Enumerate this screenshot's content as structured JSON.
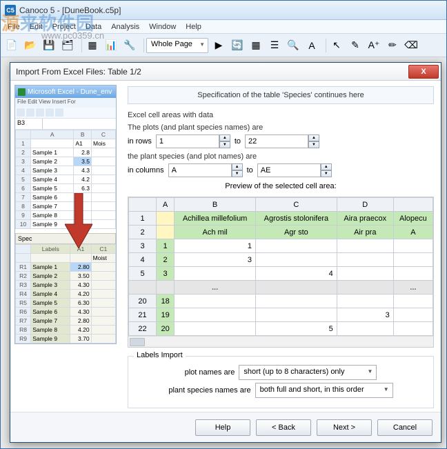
{
  "window": {
    "title": "Canoco 5 - [DuneBook.c5p]",
    "icon_label": "C5"
  },
  "watermark": {
    "main_a": "源",
    "main_b": "来软件园",
    "sub": "www.pc0359.cn"
  },
  "menubar": [
    "File",
    "Edit",
    "Project",
    "Data",
    "Analysis",
    "Window",
    "Help"
  ],
  "toolbar": {
    "zoom": "Whole Page"
  },
  "dialog": {
    "title": "Import From Excel Files: Table 1/2",
    "close": "X",
    "spec_header": "Specification of the table 'Species' continues here",
    "cell_areas_label": "Excel cell areas with data",
    "rows_label": "The plots (and plant species names) are",
    "in_rows": "in rows",
    "from_row": "1",
    "to_label": "to",
    "to_row": "22",
    "cols_label": "the plant species (and plot names) are",
    "in_cols": "in columns",
    "from_col": "A",
    "to_col": "AE",
    "preview_label": "Preview of the selected cell area:",
    "preview": {
      "cols": [
        "A",
        "B",
        "C",
        "D",
        ""
      ],
      "rows": [
        {
          "n": "1",
          "a": "",
          "b": "Achillea millefolium",
          "c": "Agrostis stolonifera",
          "d": "Aira praecox",
          "e": "Alopecu",
          "green_row": true
        },
        {
          "n": "2",
          "a": "",
          "b": "Ach mil",
          "c": "Agr sto",
          "d": "Air pra",
          "e": "A",
          "green_row": true
        },
        {
          "n": "3",
          "a": "1",
          "b": "1",
          "c": "",
          "d": "",
          "e": ""
        },
        {
          "n": "4",
          "a": "2",
          "b": "3",
          "c": "",
          "d": "",
          "e": ""
        },
        {
          "n": "5",
          "a": "3",
          "b": "",
          "c": "4",
          "d": "",
          "e": ""
        }
      ],
      "rows2": [
        {
          "n": "20",
          "a": "18",
          "b": "",
          "c": "",
          "d": "",
          "e": ""
        },
        {
          "n": "21",
          "a": "19",
          "b": "",
          "c": "",
          "d": "3",
          "e": ""
        },
        {
          "n": "22",
          "a": "20",
          "b": "",
          "c": "5",
          "d": "",
          "e": ""
        }
      ],
      "ellipsis": "..."
    },
    "labels_import": "Labels Import",
    "plot_names_label": "plot names are",
    "plot_names_value": "short (up to 8 characters) only",
    "species_names_label": "plant species names are",
    "species_names_value": "both full and short, in this order",
    "buttons": {
      "help": "Help",
      "back": "< Back",
      "next": "Next >",
      "cancel": "Cancel"
    }
  },
  "excel_thumb": {
    "title": "Microsoft Excel - Dune_env",
    "menu": "File  Edit  View  Insert  For",
    "cellref": "B3",
    "headers": [
      "",
      "A",
      "B",
      "C"
    ],
    "moist": "Mois",
    "label_hdr": "A1",
    "rows": [
      {
        "n": "1",
        "a": "",
        "b": "A1",
        "c": "Mois"
      },
      {
        "n": "2",
        "a": "Sample 1",
        "b": "2.8",
        "c": ""
      },
      {
        "n": "3",
        "a": "Sample 2",
        "b": "3.5",
        "c": ""
      },
      {
        "n": "4",
        "a": "Sample 3",
        "b": "4.3",
        "c": ""
      },
      {
        "n": "5",
        "a": "Sample 4",
        "b": "4.2",
        "c": ""
      },
      {
        "n": "6",
        "a": "Sample 5",
        "b": "6.3",
        "c": ""
      },
      {
        "n": "7",
        "a": "Sample 6",
        "b": "",
        "c": ""
      },
      {
        "n": "8",
        "a": "Sample 7",
        "b": "",
        "c": ""
      },
      {
        "n": "9",
        "a": "Sample 8",
        "b": "",
        "c": ""
      },
      {
        "n": "10",
        "a": "Sample 9",
        "b": "",
        "c": ""
      }
    ],
    "spec_tab": "Spec",
    "bottom_headers": [
      "",
      "Labels",
      "A1",
      "C1"
    ],
    "bottom_moist": "Moist",
    "bottom_rows": [
      {
        "r": "R1",
        "l": "Sample 1",
        "v": "2.80"
      },
      {
        "r": "R2",
        "l": "Sample 2",
        "v": "3.50"
      },
      {
        "r": "R3",
        "l": "Sample 3",
        "v": "4.30"
      },
      {
        "r": "R4",
        "l": "Sample 4",
        "v": "4.20"
      },
      {
        "r": "R5",
        "l": "Sample 5",
        "v": "6.30"
      },
      {
        "r": "R6",
        "l": "Sample 6",
        "v": "4.30"
      },
      {
        "r": "R7",
        "l": "Sample 7",
        "v": "2.80"
      },
      {
        "r": "R8",
        "l": "Sample 8",
        "v": "4.20"
      },
      {
        "r": "R9",
        "l": "Sample 9",
        "v": "3.70"
      }
    ]
  }
}
